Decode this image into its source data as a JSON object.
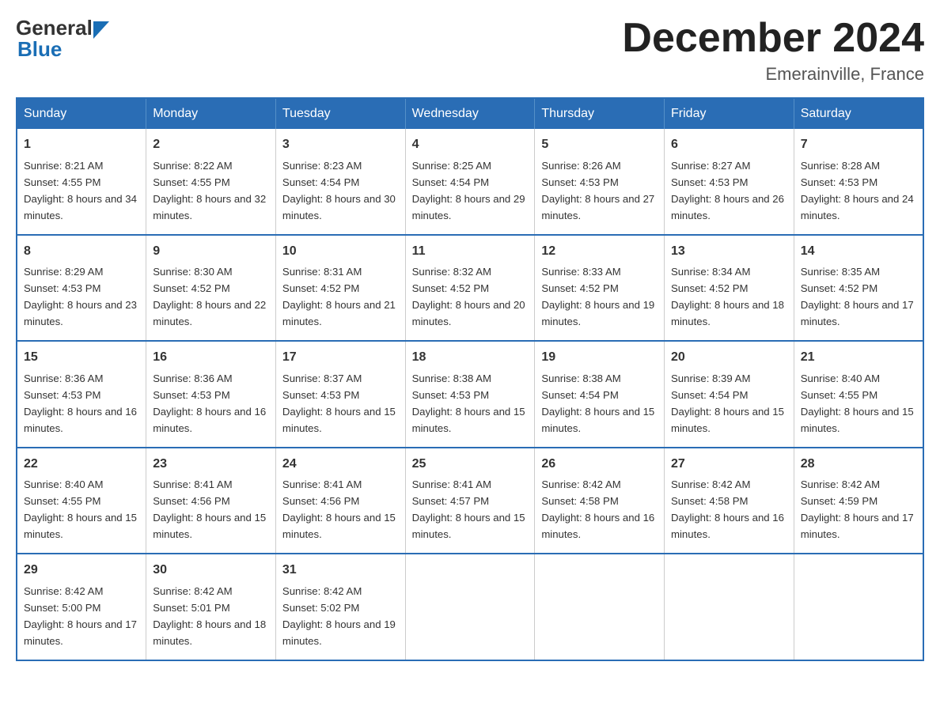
{
  "header": {
    "logo_general": "General",
    "logo_blue": "Blue",
    "month_title": "December 2024",
    "location": "Emerainville, France"
  },
  "days_of_week": [
    "Sunday",
    "Monday",
    "Tuesday",
    "Wednesday",
    "Thursday",
    "Friday",
    "Saturday"
  ],
  "weeks": [
    [
      {
        "day": "1",
        "sunrise": "8:21 AM",
        "sunset": "4:55 PM",
        "daylight": "8 hours and 34 minutes."
      },
      {
        "day": "2",
        "sunrise": "8:22 AM",
        "sunset": "4:55 PM",
        "daylight": "8 hours and 32 minutes."
      },
      {
        "day": "3",
        "sunrise": "8:23 AM",
        "sunset": "4:54 PM",
        "daylight": "8 hours and 30 minutes."
      },
      {
        "day": "4",
        "sunrise": "8:25 AM",
        "sunset": "4:54 PM",
        "daylight": "8 hours and 29 minutes."
      },
      {
        "day": "5",
        "sunrise": "8:26 AM",
        "sunset": "4:53 PM",
        "daylight": "8 hours and 27 minutes."
      },
      {
        "day": "6",
        "sunrise": "8:27 AM",
        "sunset": "4:53 PM",
        "daylight": "8 hours and 26 minutes."
      },
      {
        "day": "7",
        "sunrise": "8:28 AM",
        "sunset": "4:53 PM",
        "daylight": "8 hours and 24 minutes."
      }
    ],
    [
      {
        "day": "8",
        "sunrise": "8:29 AM",
        "sunset": "4:53 PM",
        "daylight": "8 hours and 23 minutes."
      },
      {
        "day": "9",
        "sunrise": "8:30 AM",
        "sunset": "4:52 PM",
        "daylight": "8 hours and 22 minutes."
      },
      {
        "day": "10",
        "sunrise": "8:31 AM",
        "sunset": "4:52 PM",
        "daylight": "8 hours and 21 minutes."
      },
      {
        "day": "11",
        "sunrise": "8:32 AM",
        "sunset": "4:52 PM",
        "daylight": "8 hours and 20 minutes."
      },
      {
        "day": "12",
        "sunrise": "8:33 AM",
        "sunset": "4:52 PM",
        "daylight": "8 hours and 19 minutes."
      },
      {
        "day": "13",
        "sunrise": "8:34 AM",
        "sunset": "4:52 PM",
        "daylight": "8 hours and 18 minutes."
      },
      {
        "day": "14",
        "sunrise": "8:35 AM",
        "sunset": "4:52 PM",
        "daylight": "8 hours and 17 minutes."
      }
    ],
    [
      {
        "day": "15",
        "sunrise": "8:36 AM",
        "sunset": "4:53 PM",
        "daylight": "8 hours and 16 minutes."
      },
      {
        "day": "16",
        "sunrise": "8:36 AM",
        "sunset": "4:53 PM",
        "daylight": "8 hours and 16 minutes."
      },
      {
        "day": "17",
        "sunrise": "8:37 AM",
        "sunset": "4:53 PM",
        "daylight": "8 hours and 15 minutes."
      },
      {
        "day": "18",
        "sunrise": "8:38 AM",
        "sunset": "4:53 PM",
        "daylight": "8 hours and 15 minutes."
      },
      {
        "day": "19",
        "sunrise": "8:38 AM",
        "sunset": "4:54 PM",
        "daylight": "8 hours and 15 minutes."
      },
      {
        "day": "20",
        "sunrise": "8:39 AM",
        "sunset": "4:54 PM",
        "daylight": "8 hours and 15 minutes."
      },
      {
        "day": "21",
        "sunrise": "8:40 AM",
        "sunset": "4:55 PM",
        "daylight": "8 hours and 15 minutes."
      }
    ],
    [
      {
        "day": "22",
        "sunrise": "8:40 AM",
        "sunset": "4:55 PM",
        "daylight": "8 hours and 15 minutes."
      },
      {
        "day": "23",
        "sunrise": "8:41 AM",
        "sunset": "4:56 PM",
        "daylight": "8 hours and 15 minutes."
      },
      {
        "day": "24",
        "sunrise": "8:41 AM",
        "sunset": "4:56 PM",
        "daylight": "8 hours and 15 minutes."
      },
      {
        "day": "25",
        "sunrise": "8:41 AM",
        "sunset": "4:57 PM",
        "daylight": "8 hours and 15 minutes."
      },
      {
        "day": "26",
        "sunrise": "8:42 AM",
        "sunset": "4:58 PM",
        "daylight": "8 hours and 16 minutes."
      },
      {
        "day": "27",
        "sunrise": "8:42 AM",
        "sunset": "4:58 PM",
        "daylight": "8 hours and 16 minutes."
      },
      {
        "day": "28",
        "sunrise": "8:42 AM",
        "sunset": "4:59 PM",
        "daylight": "8 hours and 17 minutes."
      }
    ],
    [
      {
        "day": "29",
        "sunrise": "8:42 AM",
        "sunset": "5:00 PM",
        "daylight": "8 hours and 17 minutes."
      },
      {
        "day": "30",
        "sunrise": "8:42 AM",
        "sunset": "5:01 PM",
        "daylight": "8 hours and 18 minutes."
      },
      {
        "day": "31",
        "sunrise": "8:42 AM",
        "sunset": "5:02 PM",
        "daylight": "8 hours and 19 minutes."
      },
      null,
      null,
      null,
      null
    ]
  ],
  "labels": {
    "sunrise": "Sunrise:",
    "sunset": "Sunset:",
    "daylight": "Daylight:"
  }
}
